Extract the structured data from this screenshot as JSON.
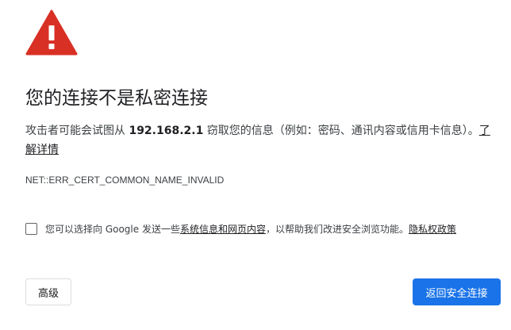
{
  "icon": {
    "name": "warning-triangle-icon",
    "color": "#d93025"
  },
  "heading": "您的连接不是私密连接",
  "description": {
    "before_ip": "攻击者可能会试图从 ",
    "ip": "192.168.2.1",
    "after_ip": " 窃取您的信息（例如：密码、通讯内容或信用卡信息）。",
    "learn_more": "了解详情"
  },
  "error_code": "NET::ERR_CERT_COMMON_NAME_INVALID",
  "consent": {
    "checked": false,
    "before_link": "您可以选择向 Google 发送一些",
    "system_info_link": "系统信息和网页内容",
    "after_link": "，以帮助我们改进安全浏览功能。",
    "privacy_link": "隐私权政策"
  },
  "buttons": {
    "advanced": "高级",
    "back_to_safety": "返回安全连接"
  },
  "colors": {
    "primary_button": "#1a73e8",
    "text": "#202124",
    "secondary_text": "#3c4043"
  }
}
